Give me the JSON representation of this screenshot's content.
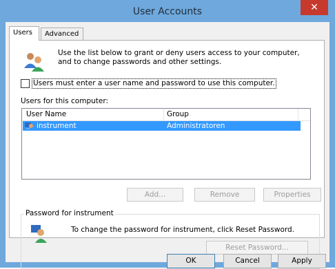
{
  "window": {
    "title": "User Accounts",
    "close_glyph": "✕",
    "title_color": "#6fa8dc",
    "close_color": "#c7392d"
  },
  "tabs": [
    {
      "label": "Users",
      "active": true
    },
    {
      "label": "Advanced",
      "active": false
    }
  ],
  "users_panel": {
    "intro_line1": "Use the list below to grant or deny users access to your computer,",
    "intro_line2": "and to change passwords and other settings.",
    "must_enter_checkbox": {
      "label": "Users must enter a user name and password to use this computer.",
      "checked": false
    },
    "users_list_label": "Users for this computer:",
    "columns": [
      "User Name",
      "Group"
    ],
    "rows": [
      {
        "user": "instrument",
        "group": "Administratoren",
        "selected": true
      }
    ],
    "buttons": {
      "add": "Add...",
      "remove": "Remove",
      "properties": "Properties"
    },
    "password_group": {
      "title": "Password for instrument",
      "text": "To change the password for instrument, click Reset Password.",
      "reset_button": "Reset Password..."
    }
  },
  "footer": {
    "ok": "OK",
    "cancel": "Cancel",
    "apply": "Apply"
  },
  "icons": {
    "users": "users-icon",
    "user_row": "user-icon",
    "password": "password-key-icon"
  },
  "colors": {
    "selection": "#3399ff",
    "accent": "#3c7fb1"
  }
}
